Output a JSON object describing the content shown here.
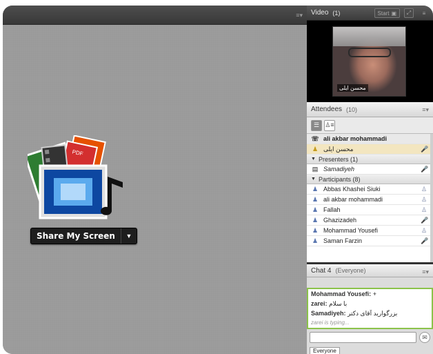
{
  "video_pod": {
    "title": "Video",
    "count": "(1)",
    "start_label": "Start",
    "camera_name": "محسن ایلی"
  },
  "attendees_pod": {
    "title": "Attendees",
    "count": "(10)",
    "me": {
      "name": "ali akbar mohammadi"
    },
    "hosts": [
      {
        "name": "محسن ایلی"
      }
    ],
    "presenters_label": "Presenters (1)",
    "presenters": [
      {
        "name": "Samadiyeh"
      }
    ],
    "participants_label": "Participants (8)",
    "participants": [
      {
        "name": "Abbas Khashei Siuki"
      },
      {
        "name": "ali akbar mohammadi"
      },
      {
        "name": "Fallah"
      },
      {
        "name": "Ghazizadeh"
      },
      {
        "name": "Mohammad Yousefi"
      },
      {
        "name": "Saman Farzin"
      }
    ]
  },
  "chat_pod": {
    "title": "Chat 4",
    "scope": "(Everyone)",
    "messages": [
      {
        "sender": "Mohammad Yousefi:",
        "text": "+"
      },
      {
        "sender": "zarei:",
        "text": "با سلام"
      },
      {
        "sender": "Samadiyeh:",
        "text": "بزرگوارید آقای دکتر"
      }
    ],
    "typing": "zarei is typing...",
    "tab_label": "Everyone"
  },
  "share_pod": {
    "button_label": "Share My Screen"
  },
  "colors": {
    "share_bg": "#9a9a9a",
    "chat_border": "#8bc34a",
    "mic_active": "#b32020"
  }
}
